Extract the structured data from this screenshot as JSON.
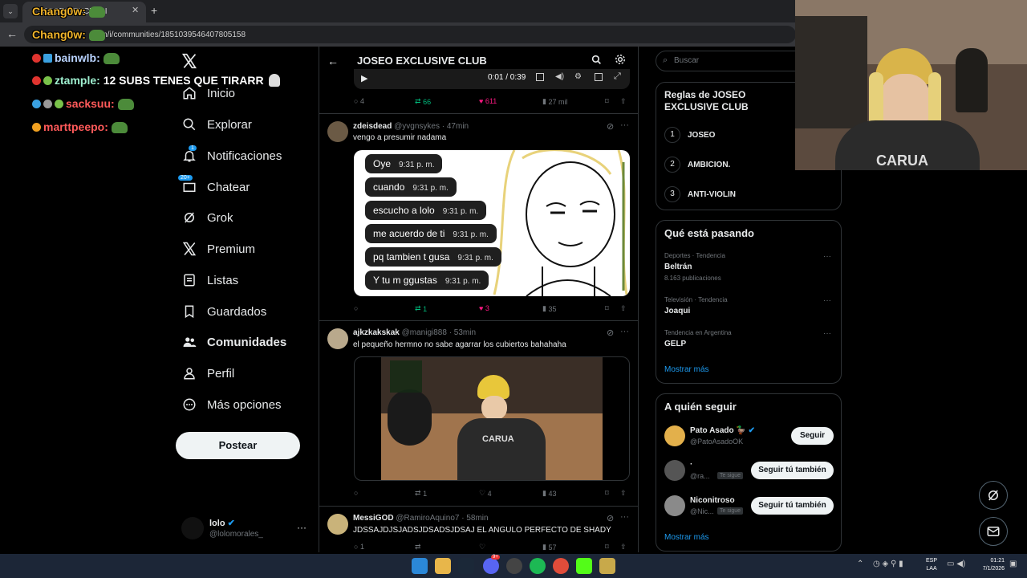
{
  "browser": {
    "tab_title": "JOSEO EXCLUSI",
    "tab_close": "✕",
    "new_tab": "+",
    "url": ".com/i/communities/1851039546407805158"
  },
  "stream_chat": [
    {
      "user": "Chang0w:",
      "text": ""
    },
    {
      "user": "Chang0w:",
      "text": ""
    },
    {
      "user": "bainwlb:",
      "text": ""
    },
    {
      "user": "ztample:",
      "text": "12 SUBS TENES QUE TIRARR"
    },
    {
      "user": "sacksuu:",
      "text": ""
    },
    {
      "user": "marttpeepo:",
      "text": ""
    }
  ],
  "nav": {
    "items": [
      {
        "label": "Inicio"
      },
      {
        "label": "Explorar"
      },
      {
        "label": "Notificaciones",
        "badge": "1"
      },
      {
        "label": "Chatear",
        "badge": "20+"
      },
      {
        "label": "Grok"
      },
      {
        "label": "Premium"
      },
      {
        "label": "Listas"
      },
      {
        "label": "Guardados"
      },
      {
        "label": "Comunidades"
      },
      {
        "label": "Perfil"
      },
      {
        "label": "Más opciones"
      }
    ],
    "post_label": "Postear",
    "account_name": "lolo",
    "account_handle": "@lolomorales_",
    "more": "···"
  },
  "header": {
    "title": "JOSEO EXCLUSIVE CLUB"
  },
  "video_bar": {
    "time": "0:01 / 0:39"
  },
  "posts": [
    {
      "replies": "4",
      "reposts": "66",
      "likes": "611",
      "views": "27 mil"
    },
    {
      "name": "zdeisdead",
      "handle": "@yvgnsykes",
      "time": "· 47min",
      "text": "vengo a presumir nadama",
      "replies": "",
      "reposts": "1",
      "likes": "3",
      "views": "35",
      "messages": [
        {
          "text": "Oye",
          "time": "9:31 p. m."
        },
        {
          "text": "cuando",
          "time": "9:31 p. m."
        },
        {
          "text": "escucho a lolo",
          "time": "9:31 p. m."
        },
        {
          "text": "me acuerdo de ti",
          "time": "9:31 p. m."
        },
        {
          "text": "pq tambien t gusa",
          "time": "9:31 p. m."
        },
        {
          "text": "Y tu m ggustas",
          "time": "9:31 p. m."
        }
      ]
    },
    {
      "name": "ajkzkakskak",
      "handle": "@manigi888",
      "time": "· 53min",
      "text": "el pequeño hermno no sabe agarrar los cubiertos bahahaha",
      "replies": "",
      "reposts": "1",
      "likes": "4",
      "views": "43",
      "shirt_text": "CARUA"
    },
    {
      "name": "MessiGOD",
      "handle": "@RamiroAquino7",
      "time": "· 58min",
      "text": "JDSSAJDJSJADSJDSADSJDSAJ EL ANGULO PERFECTO DE SHADY",
      "replies": "1",
      "reposts": "",
      "likes": "",
      "views": "57"
    }
  ],
  "search": {
    "placeholder": "Buscar"
  },
  "rules": {
    "title": "Reglas de JOSEO EXCLUSIVE CLUB",
    "items": [
      {
        "num": "1",
        "label": "JOSEO"
      },
      {
        "num": "2",
        "label": "AMBICION."
      },
      {
        "num": "3",
        "label": "ANTI-VIOLIN"
      }
    ]
  },
  "trends": {
    "title": "Qué está pasando",
    "items": [
      {
        "category": "Deportes · Tendencia",
        "name": "Beltrán",
        "count": "8.163 publicaciones"
      },
      {
        "category": "Televisión · Tendencia",
        "name": "Joaqui",
        "count": ""
      },
      {
        "category": "Tendencia en Argentina",
        "name": "GELP",
        "count": ""
      }
    ],
    "more": "Mostrar más"
  },
  "who_to_follow": {
    "title": "A quién seguir",
    "items": [
      {
        "name": "Pato Asado 🦆",
        "handle": "@PatoAsadoOK",
        "follows_you": "",
        "button": "Seguir"
      },
      {
        "name": "·",
        "handle": "@ra...",
        "follows_you": "Te sigue",
        "button": "Seguir tú también"
      },
      {
        "name": "Niconitroso",
        "handle": "@Nic...",
        "follows_you": "Te sigue",
        "button": "Seguir tú también"
      }
    ],
    "more": "Mostrar más"
  },
  "webcam_shirt": "CARUA",
  "taskbar": {
    "lang": "ESP",
    "lang2": "LAA",
    "time": "01:21",
    "date": "7/1/2026",
    "discord_badge": "9+"
  },
  "colors": {
    "accent": "#1d9bf0",
    "like": "#f91880",
    "repost": "#00ba7c",
    "border": "#2f3336"
  }
}
